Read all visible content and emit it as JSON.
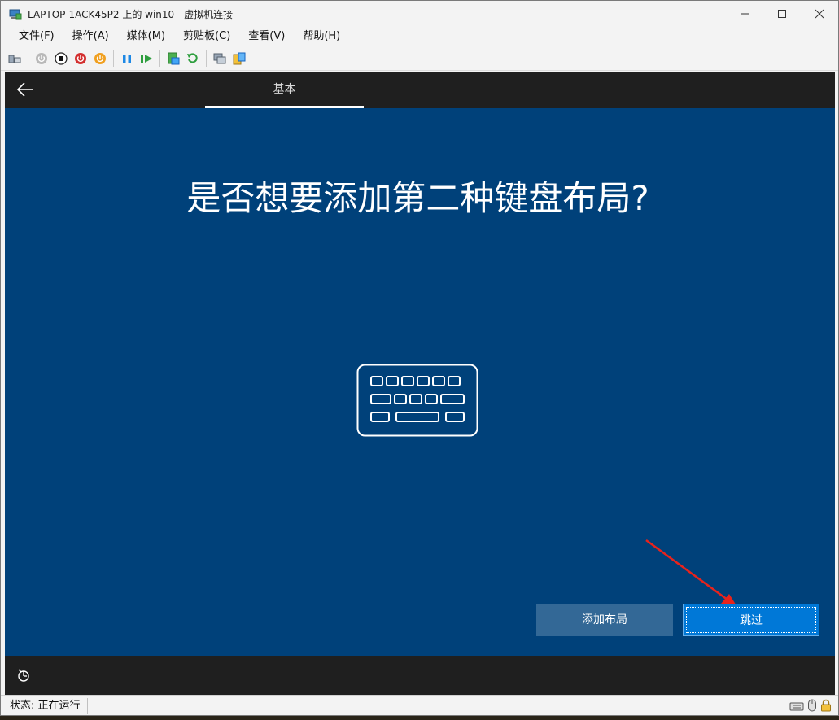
{
  "window": {
    "title": "LAPTOP-1ACK45P2 上的 win10 - 虚拟机连接",
    "minimize": "—",
    "maximize": "☐",
    "close": "✕"
  },
  "menu": [
    "文件(F)",
    "操作(A)",
    "媒体(M)",
    "剪贴板(C)",
    "查看(V)",
    "帮助(H)"
  ],
  "toolbar_icons": [
    "ctrl-alt-del-icon",
    "start-icon",
    "turn-off-icon",
    "shut-down-icon",
    "save-icon",
    "pause-icon",
    "resume-icon",
    "checkpoint-icon",
    "revert-icon",
    "enhanced-session-icon",
    "share-icon"
  ],
  "oobe": {
    "step": "基本",
    "heading": "是否想要添加第二种键盘布局?",
    "add_layout": "添加布局",
    "skip": "跳过"
  },
  "status": {
    "text": "状态: 正在运行"
  },
  "colors": {
    "oobe_background": "#00417a",
    "primary_button": "#0078d7",
    "secondary_button": "#336896",
    "annotation_arrow": "#e8231c"
  }
}
